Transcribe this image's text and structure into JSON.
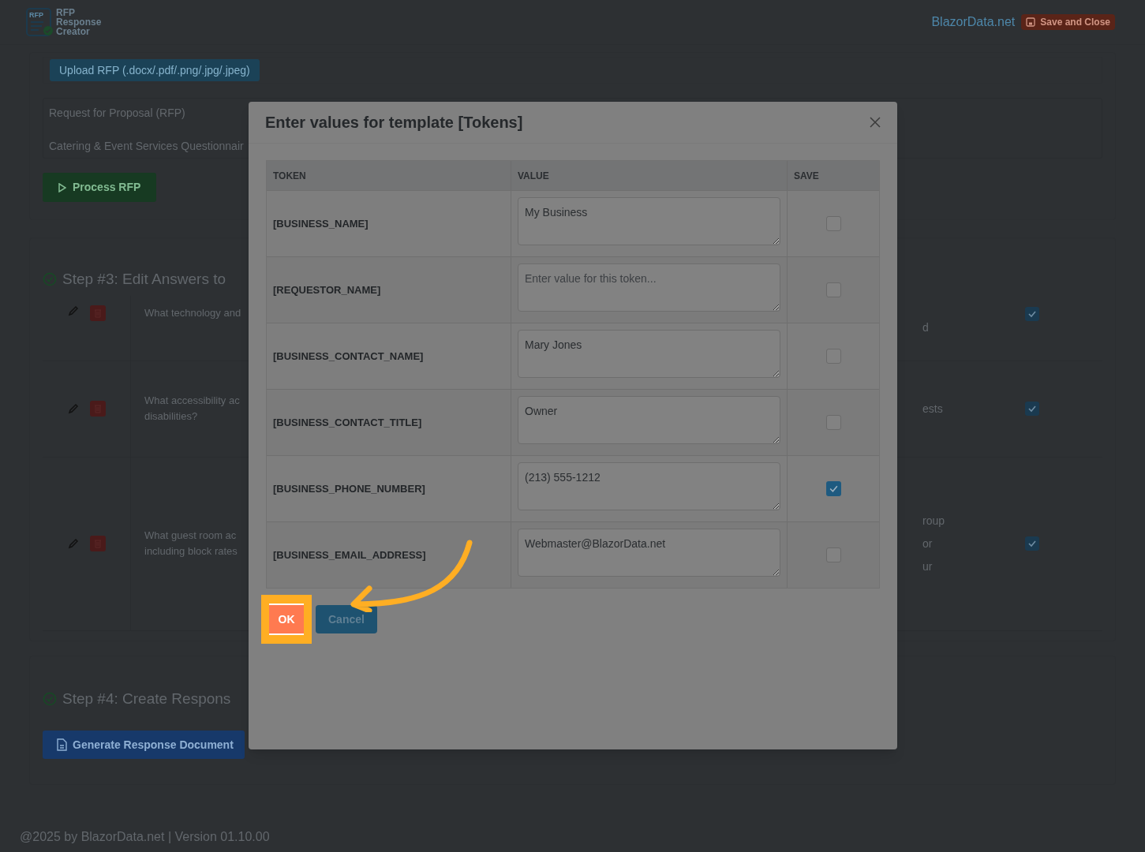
{
  "header": {
    "logo_badge": "RFP",
    "logo_lines": [
      "RFP",
      "Response",
      "Creator"
    ],
    "site_link": "BlazorData.net",
    "save_button": "Save and Close"
  },
  "upload": {
    "button": "Upload RFP (.docx/.pdf/.png/.jpg/.jpeg)",
    "rfp_lines": [
      "Request for Proposal (RFP)",
      "Catering & Event Services Questionnair"
    ],
    "process_button": "Process RFP"
  },
  "step3": {
    "title": "Step #3: Edit Answers to",
    "rows": [
      {
        "question": [
          "What technology and"
        ],
        "answer_fragments": [
          "d"
        ],
        "checked": true
      },
      {
        "question": [
          "What accessibility ac",
          "disabilities?"
        ],
        "answer_fragments": [
          "ests"
        ],
        "checked": true
      },
      {
        "question": [
          "What guest room ac",
          "including block rates"
        ],
        "answer_fragments": [
          "roup",
          "or",
          "ur"
        ],
        "checked": true
      }
    ]
  },
  "step4": {
    "title": "Step #4: Create Respons",
    "button": "Generate Response Document"
  },
  "footer": "@2025 by BlazorData.net | Version 01.10.00",
  "modal": {
    "title": "Enter values for template [Tokens]",
    "columns": [
      "TOKEN",
      "VALUE",
      "SAVE"
    ],
    "rows": [
      {
        "token": "[BUSINESS_NAME]",
        "value": "My Business",
        "save": false
      },
      {
        "token": "[REQUESTOR_NAME]",
        "placeholder": "Enter value for this token...",
        "save": false
      },
      {
        "token": "[BUSINESS_CONTACT_NAME]",
        "value": "Mary Jones",
        "save": false
      },
      {
        "token": "[BUSINESS_CONTACT_TITLE]",
        "value": "Owner",
        "save": false
      },
      {
        "token": "[BUSINESS_PHONE_NUMBER]",
        "value": "(213) 555-1212",
        "save": true
      },
      {
        "token": "[BUSINESS_EMAIL_ADDRESS]",
        "value": "Webmaster@BlazorData.net",
        "save": false
      }
    ],
    "ok_button": "OK",
    "cancel_button": "Cancel"
  }
}
